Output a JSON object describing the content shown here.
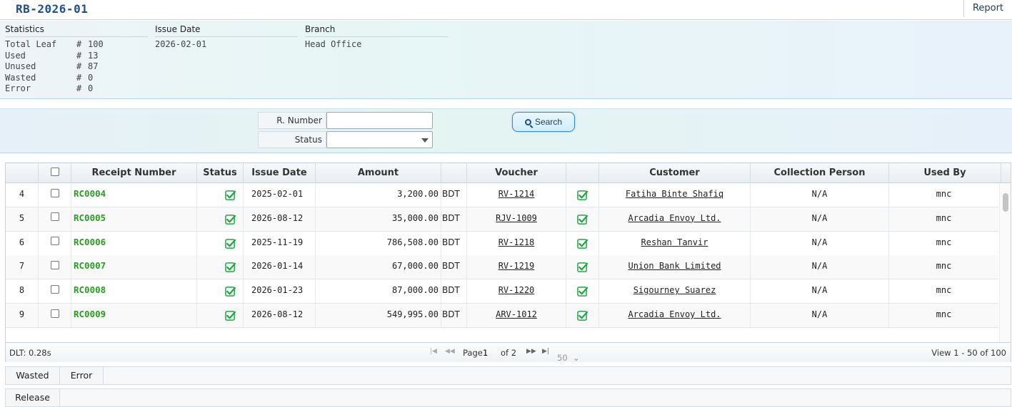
{
  "header": {
    "title": "RB-2026-01",
    "report_label": "Report"
  },
  "stats": {
    "statistics_head": "Statistics",
    "issue_date_head": "Issue Date",
    "branch_head": "Branch",
    "rows": [
      {
        "label": "Total Leaf",
        "hash": "#",
        "value": "100"
      },
      {
        "label": "Used",
        "hash": "#",
        "value": "13"
      },
      {
        "label": "Unused",
        "hash": "#",
        "value": "87"
      },
      {
        "label": "Wasted",
        "hash": "#",
        "value": "0"
      },
      {
        "label": "Error",
        "hash": "#",
        "value": "0"
      }
    ],
    "issue_date": "2026-02-01",
    "branch": "Head Office"
  },
  "search": {
    "rnumber_label": "R. Number",
    "rnumber_value": "",
    "status_label": "Status",
    "status_value": "",
    "button_label": "Search"
  },
  "grid": {
    "columns": [
      "",
      "",
      "Receipt Number",
      "Status",
      "Issue Date",
      "Amount",
      "",
      "Voucher",
      "",
      "Customer",
      "Collection Person",
      "Used By"
    ],
    "rows": [
      {
        "num": "4",
        "receipt": "RC0004",
        "issue_date": "2025-02-01",
        "amount": "3,200.00",
        "currency": "BDT",
        "voucher": "RV-1214",
        "customer": "Fatiha Binte Shafiq",
        "collection_person": "N/A",
        "used_by": "mnc"
      },
      {
        "num": "5",
        "receipt": "RC0005",
        "issue_date": "2026-08-12",
        "amount": "35,000.00",
        "currency": "BDT",
        "voucher": "RJV-1009",
        "customer": "Arcadia Envoy Ltd.",
        "collection_person": "N/A",
        "used_by": "mnc"
      },
      {
        "num": "6",
        "receipt": "RC0006",
        "issue_date": "2025-11-19",
        "amount": "786,508.00",
        "currency": "BDT",
        "voucher": "RV-1218",
        "customer": "Reshan Tanvir",
        "collection_person": "N/A",
        "used_by": "mnc"
      },
      {
        "num": "7",
        "receipt": "RC0007",
        "issue_date": "2026-01-14",
        "amount": "67,000.00",
        "currency": "BDT",
        "voucher": "RV-1219",
        "customer": "Union Bank Limited",
        "collection_person": "N/A",
        "used_by": "mnc"
      },
      {
        "num": "8",
        "receipt": "RC0008",
        "issue_date": "2026-01-23",
        "amount": "87,000.00",
        "currency": "BDT",
        "voucher": "RV-1220",
        "customer": "Sigourney Suarez",
        "collection_person": "N/A",
        "used_by": "mnc"
      },
      {
        "num": "9",
        "receipt": "RC0009",
        "issue_date": "2026-08-12",
        "amount": "549,995.00",
        "currency": "BDT",
        "voucher": "ARV-1012",
        "customer": "Arcadia Envoy Ltd.",
        "collection_person": "N/A",
        "used_by": "mnc"
      }
    ]
  },
  "pager": {
    "dlt": "DLT: 0.28s",
    "page_label": "Page",
    "page_value": "1",
    "of_label": "of 2",
    "page_size": "50",
    "view_text": "View 1 - 50 of 100"
  },
  "tabs": {
    "row1": [
      "Wasted",
      "Error"
    ],
    "row2": [
      "Release"
    ]
  },
  "colors": {
    "accent": "#1f4f8c",
    "receipt_green": "#2a9d22",
    "check_green": "#22b14c"
  }
}
